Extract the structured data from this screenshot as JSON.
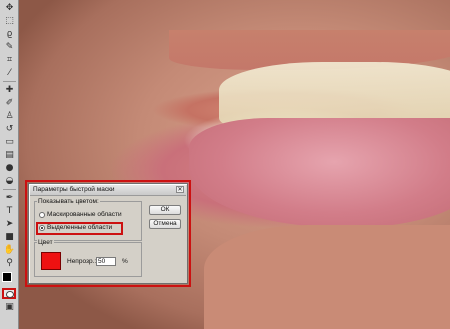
{
  "toolbar": {
    "tools": [
      "move-tool",
      "marquee-tool",
      "lasso-tool",
      "quick-selection-tool",
      "crop-tool",
      "eyedropper-tool",
      "healing-brush-tool",
      "brush-tool",
      "clone-stamp-tool",
      "history-brush-tool",
      "eraser-tool",
      "gradient-tool",
      "blur-tool",
      "dodge-tool",
      "pen-tool",
      "type-tool",
      "path-selection-tool",
      "shape-tool",
      "hand-tool",
      "zoom-tool"
    ],
    "foreground_color": "#000000",
    "background_color": "#ffffff",
    "quick_mask_active": true
  },
  "dialog": {
    "title": "Параметры быстрой маски",
    "show_group_label": "Показывать цветом:",
    "option_masked": "Маскированные области",
    "option_selected": "Выделенные области",
    "selected_option": "option_selected",
    "color_group_label": "Цвет",
    "opacity_label": "Непрозр.:",
    "opacity_value": "50",
    "opacity_unit": "%",
    "mask_color": "#ee1111",
    "ok_label": "ОК",
    "cancel_label": "Отмена"
  },
  "highlight_color": "#cc1111"
}
